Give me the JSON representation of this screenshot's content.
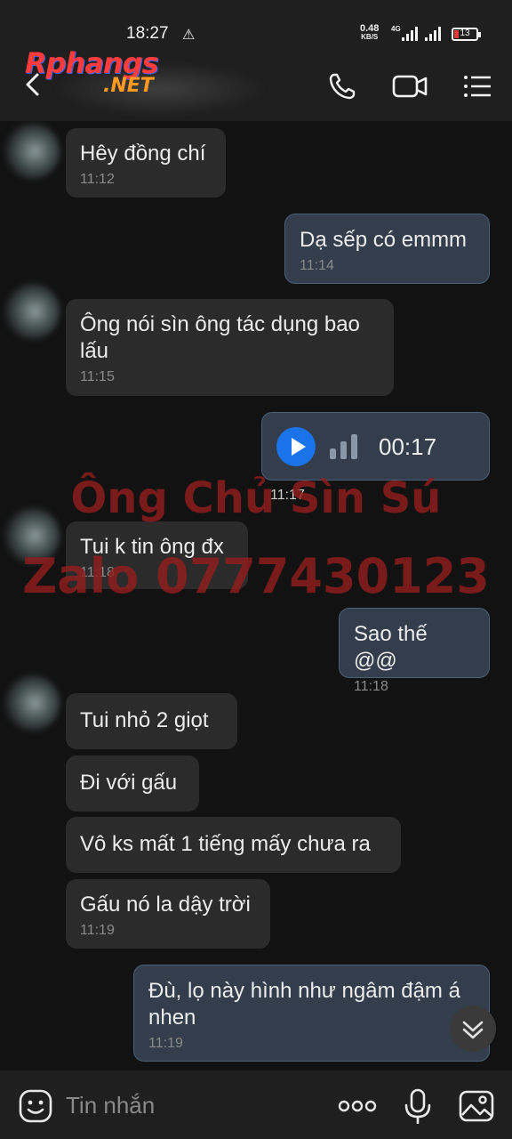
{
  "status_bar": {
    "time": "18:27",
    "net_speed_value": "0.48",
    "net_speed_unit": "KB/S",
    "network_type": "4G",
    "battery_level": "13",
    "battery_color": "#e53935"
  },
  "header": {
    "logo_main": "Rphangs",
    "logo_sub": ".NET",
    "icons": [
      "back-arrow-icon",
      "phone-icon",
      "video-call-icon",
      "menu-list-icon"
    ]
  },
  "messages": [
    {
      "dir": "in",
      "text": "Hêy đồng chí",
      "time": "11:12"
    },
    {
      "dir": "out",
      "text": "Dạ sếp có emmm",
      "time": "11:14"
    },
    {
      "dir": "in",
      "text": "Ông nói sìn ông tác dụng bao lấu",
      "time": "11:15"
    },
    {
      "dir": "out",
      "type": "voice",
      "duration": "00:17",
      "time": "11:17"
    },
    {
      "dir": "in",
      "text": "Tui k tin ông đx",
      "time": "11:18"
    },
    {
      "dir": "out",
      "text": "Sao thế @@",
      "time": "11:18"
    },
    {
      "dir": "in",
      "text": "Tui nhỏ 2 giọt"
    },
    {
      "dir": "in",
      "text": "Đi với gấu"
    },
    {
      "dir": "in",
      "text": "Vô ks mất 1 tiếng mấy chưa ra"
    },
    {
      "dir": "in",
      "text": "Gấu nó la dậy trời",
      "time": "11:19"
    },
    {
      "dir": "out",
      "text": "Đù, lọ này hình như ngâm đậm á nhen",
      "time": "11:19"
    }
  ],
  "watermark": {
    "line1": "Ông Chủ Sìn Sú",
    "line2": "Zalo 0777430123",
    "color": "#961c1e"
  },
  "input_bar": {
    "placeholder": "Tin nhắn",
    "icons": [
      "emoji-icon",
      "more-dots-icon",
      "microphone-icon",
      "gallery-icon"
    ]
  },
  "colors": {
    "background": "#121212",
    "bubble_in": "#2b2b2b",
    "bubble_out": "#333d4b",
    "play_button": "#1a73e8"
  }
}
